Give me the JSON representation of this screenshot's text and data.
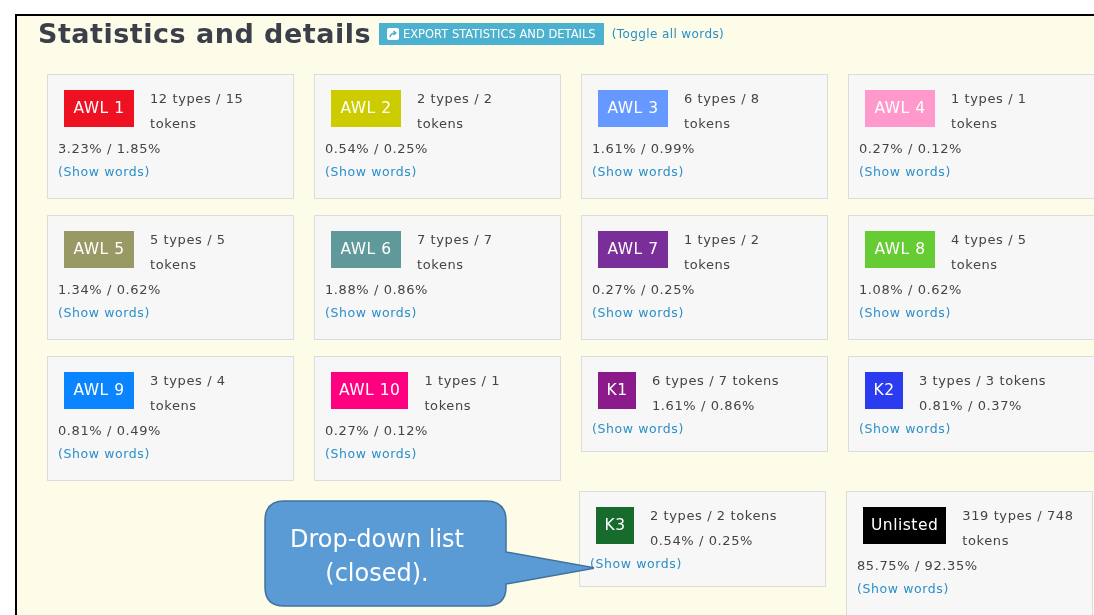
{
  "header": {
    "title": "Statistics and details",
    "export_button": "EXPORT STATISTICS AND DETAILS",
    "toggle_link": "(Toggle all words)"
  },
  "rows": [
    [
      {
        "label": "AWL 1",
        "color": "#ee1122",
        "kind": "stacked",
        "stats": "12 types / 15 tokens",
        "percent": "3.23% / 1.85%",
        "link": "(Show words)"
      },
      {
        "label": "AWL 2",
        "color": "#cccc00",
        "kind": "stacked",
        "stats": "2 types / 2 tokens",
        "percent": "0.54% / 0.25%",
        "link": "(Show words)"
      },
      {
        "label": "AWL 3",
        "color": "#6699ff",
        "kind": "stacked",
        "stats": "6 types / 8 tokens",
        "percent": "1.61% / 0.99%",
        "link": "(Show words)"
      },
      {
        "label": "AWL 4",
        "color": "#ff99cc",
        "kind": "stacked",
        "stats": "1 types / 1 tokens",
        "percent": "0.27% / 0.12%",
        "link": "(Show words)"
      }
    ],
    [
      {
        "label": "AWL 5",
        "color": "#999966",
        "kind": "stacked",
        "stats": "5 types / 5 tokens",
        "percent": "1.34% / 0.62%",
        "link": "(Show words)"
      },
      {
        "label": "AWL 6",
        "color": "#5f9999",
        "kind": "stacked",
        "stats": "7 types / 7 tokens",
        "percent": "1.88% / 0.86%",
        "link": "(Show words)"
      },
      {
        "label": "AWL 7",
        "color": "#7a2e99",
        "kind": "stacked",
        "stats": "1 types / 2 tokens",
        "percent": "0.27% / 0.25%",
        "link": "(Show words)"
      },
      {
        "label": "AWL 8",
        "color": "#66cc33",
        "kind": "stacked",
        "stats": "4 types / 5 tokens",
        "percent": "1.08% / 0.62%",
        "link": "(Show words)"
      }
    ],
    [
      {
        "label": "AWL 9",
        "color": "#0a84ff",
        "kind": "stacked",
        "stats": "3 types / 4 tokens",
        "percent": "0.81% / 0.49%",
        "link": "(Show words)"
      },
      {
        "label": "AWL 10",
        "color": "#ff0080",
        "kind": "stacked",
        "stats": "1 types / 1 tokens",
        "percent": "0.27% / 0.12%",
        "link": "(Show words)"
      },
      {
        "label": "K1",
        "color": "#8b1a8b",
        "kind": "inline",
        "stats": "6 types / 7 tokens",
        "percent": "1.61% / 0.86%",
        "link": "(Show words)"
      },
      {
        "label": "K2",
        "color": "#2b3cf0",
        "kind": "inline",
        "stats": "3 types / 3 tokens",
        "percent": "0.81% / 0.37%",
        "link": "(Show words)"
      }
    ],
    [
      {
        "label": "K3",
        "color": "#176b2c",
        "kind": "inline",
        "stats": "2 types / 2 tokens",
        "percent": "0.54% / 0.25%",
        "link": "(Show words)"
      },
      {
        "label": "Unlisted",
        "color": "#000000",
        "kind": "stacked",
        "stats": "319 types / 748 tokens",
        "percent": "85.75% / 92.35%",
        "link": "(Show words)"
      }
    ]
  ],
  "callout": {
    "text": "Drop-down list (closed)."
  }
}
